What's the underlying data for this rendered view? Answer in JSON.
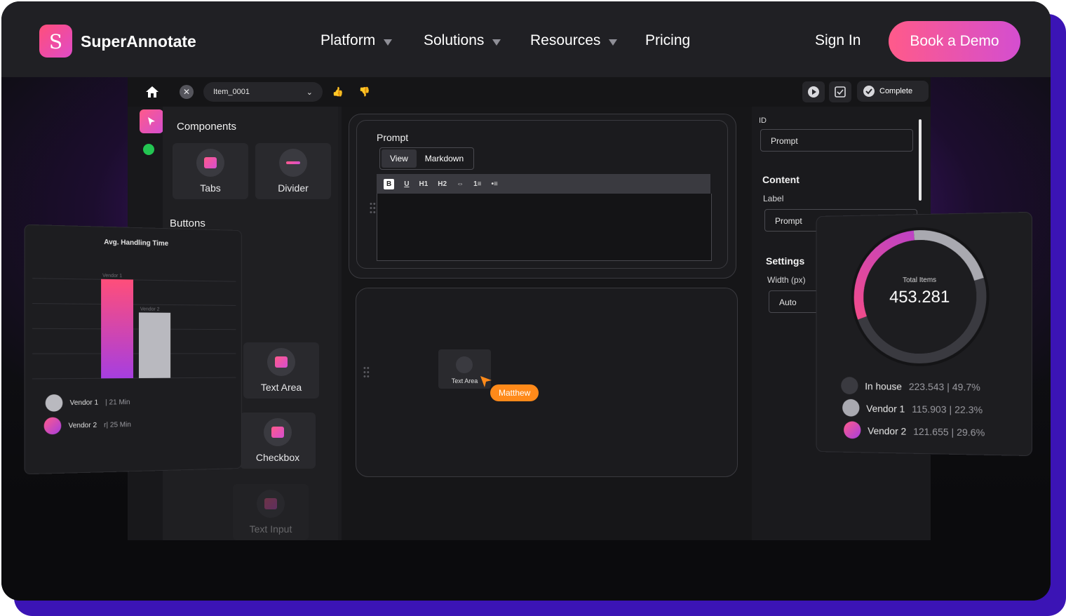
{
  "brand": {
    "name": "SuperAnnotate",
    "logo_letter": "S"
  },
  "nav": {
    "items": [
      {
        "label": "Platform",
        "has_caret": true
      },
      {
        "label": "Solutions",
        "has_caret": true
      },
      {
        "label": "Resources",
        "has_caret": true
      },
      {
        "label": "Pricing",
        "has_caret": false
      }
    ],
    "sign_in": "Sign In",
    "cta": "Book a Demo"
  },
  "app": {
    "item_select": "Item_0001",
    "complete_label": "Complete",
    "components_title": "Components",
    "buttons_title": "Buttons",
    "tiles": [
      "Tabs",
      "Divider",
      "Text Area",
      "Checkbox",
      "Text Input"
    ],
    "prompt_card": {
      "title": "Prompt",
      "tabs": [
        "View",
        "Markdown"
      ],
      "toolbar": [
        "B",
        "U",
        "H1",
        "H2",
        "⇔",
        "1≡",
        "•≡"
      ]
    },
    "drag_tile_label": "Text Area",
    "cursor_user": "Matthew",
    "props": {
      "id_label": "ID",
      "id_value": "Prompt",
      "content_title": "Content",
      "label_label": "Label",
      "label_value": "Prompt",
      "settings_title": "Settings",
      "width_label": "Width (px)",
      "width_value": "Auto"
    }
  },
  "chart_data": [
    {
      "type": "bar",
      "title": "Avg. Handling Time",
      "categories": [
        "Vendor 1",
        "Vendor 2"
      ],
      "values": [
        21,
        14
      ],
      "legend": [
        {
          "name": "Vendor 1",
          "detail": "| 21 Min",
          "color": "#b9b9bf"
        },
        {
          "name": "Vendor 2",
          "detail": "r| 25 Min",
          "color": "#e84fb0"
        }
      ]
    },
    {
      "type": "pie",
      "title": "Total Items",
      "total": "453.281",
      "slices": [
        {
          "name": "In house",
          "value": "223.543",
          "percent": "49.7%",
          "pct": 49.7,
          "color": "#3a3a40"
        },
        {
          "name": "Vendor 1",
          "value": "115.903",
          "percent": "22.3%",
          "pct": 22.3,
          "color": "#a9a9b0"
        },
        {
          "name": "Vendor 2",
          "value": "121.655",
          "percent": "29.6%",
          "pct": 29.6,
          "color": "#ec4fa0"
        }
      ]
    }
  ],
  "colors": {
    "accent_start": "#ff5a8a",
    "accent_end": "#d44ed0",
    "cursor": "#ff8a1a",
    "status_online": "#23c552"
  }
}
